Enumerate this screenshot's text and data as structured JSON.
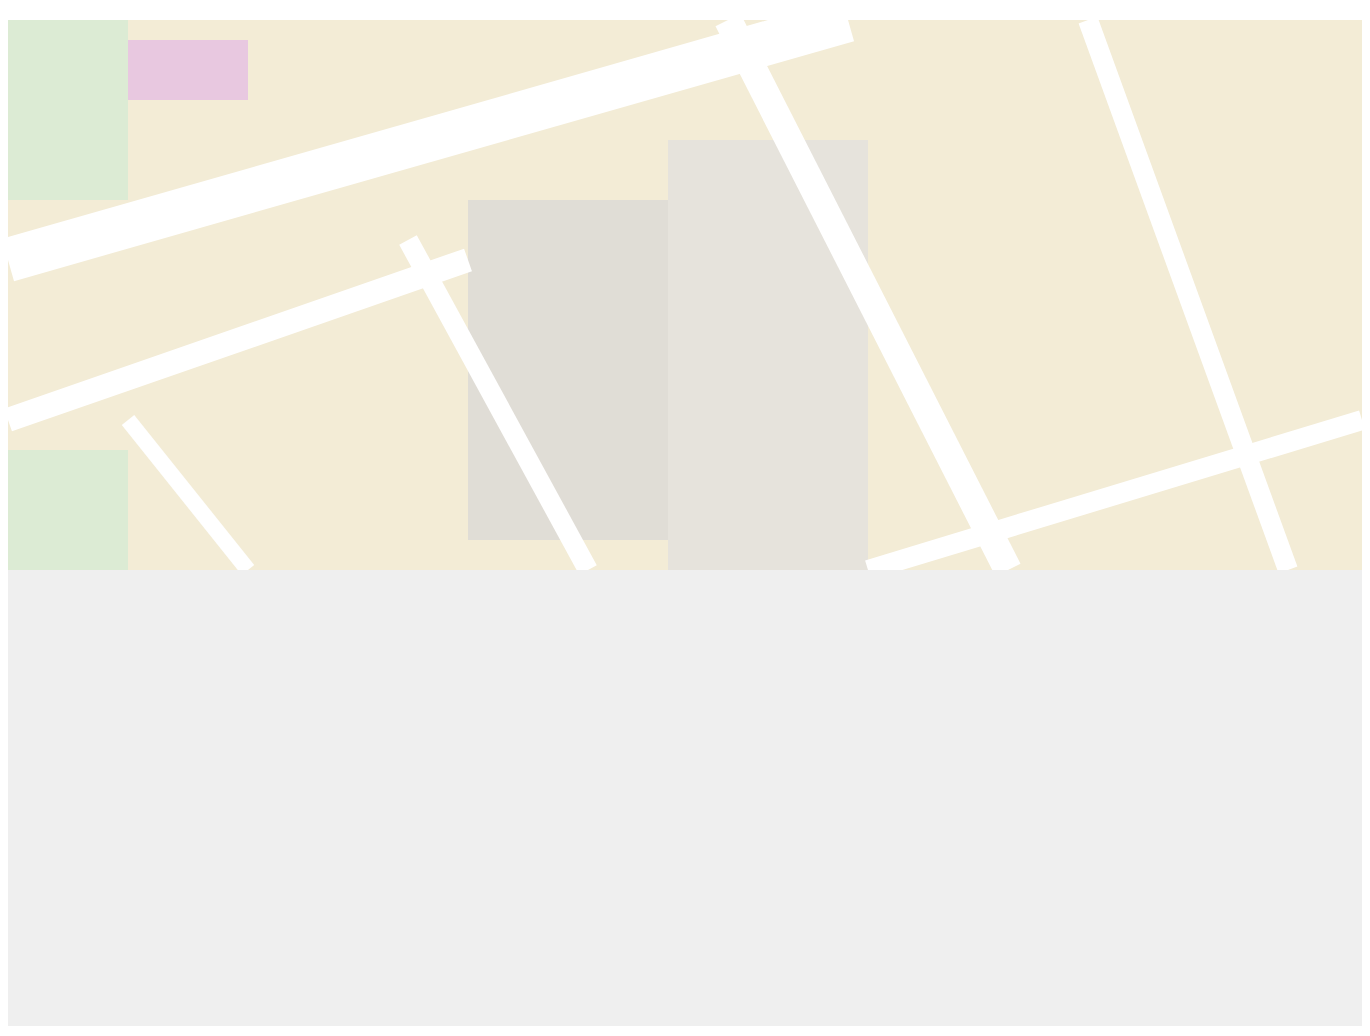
{
  "media": {
    "kind": "map"
  },
  "below": {
    "kind": "empty-panel"
  }
}
